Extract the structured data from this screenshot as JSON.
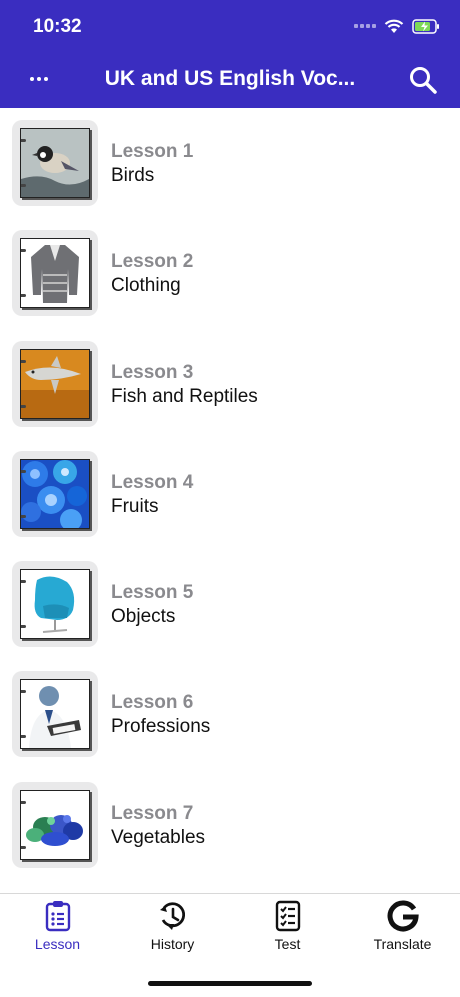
{
  "status_bar": {
    "time": "10:32"
  },
  "header": {
    "title": "UK and US English Voc..."
  },
  "lessons": [
    {
      "number": "Lesson 1",
      "name": "Birds"
    },
    {
      "number": "Lesson 2",
      "name": "Clothing"
    },
    {
      "number": "Lesson 3",
      "name": "Fish and Reptiles"
    },
    {
      "number": "Lesson 4",
      "name": "Fruits"
    },
    {
      "number": "Lesson 5",
      "name": "Objects"
    },
    {
      "number": "Lesson 6",
      "name": "Professions"
    },
    {
      "number": "Lesson 7",
      "name": "Vegetables"
    }
  ],
  "tabs": [
    {
      "label": "Lesson",
      "icon": "lesson-list-icon",
      "active": true
    },
    {
      "label": "History",
      "icon": "history-icon",
      "active": false
    },
    {
      "label": "Test",
      "icon": "test-checklist-icon",
      "active": false
    },
    {
      "label": "Translate",
      "icon": "google-translate-icon",
      "active": false
    }
  ],
  "colors": {
    "accent": "#3a2dc0",
    "lesson_number": "#8a8a8e",
    "active_tab": "#3a2dc0"
  }
}
